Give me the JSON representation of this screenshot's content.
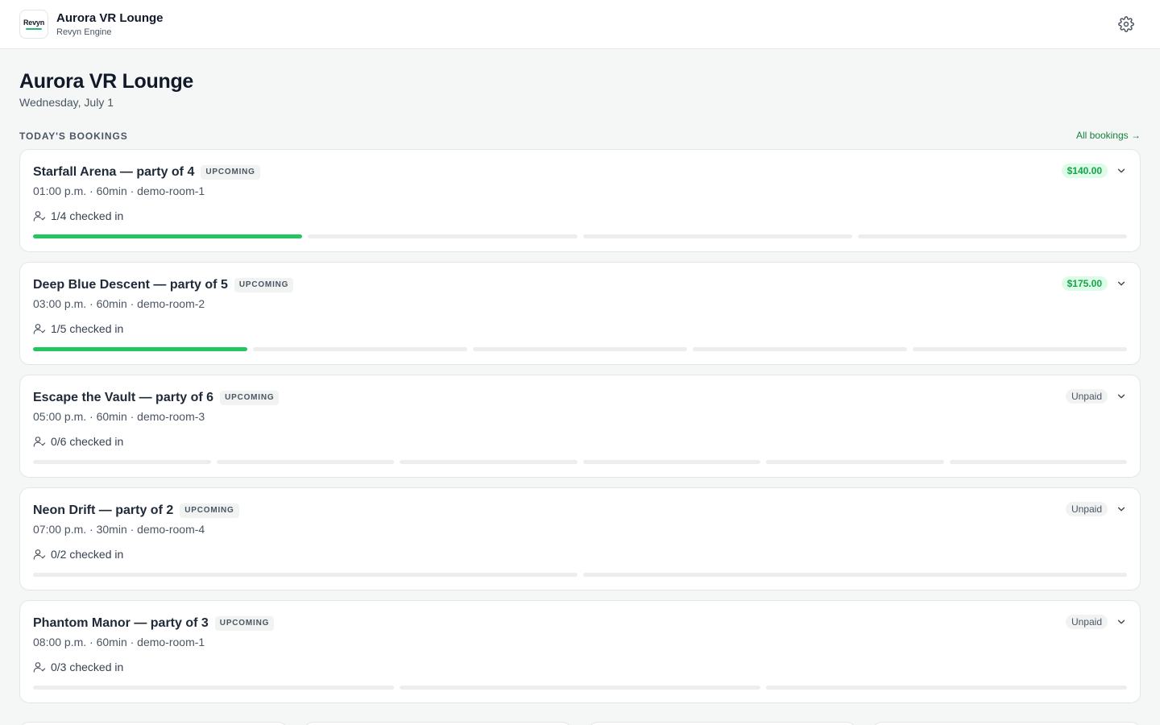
{
  "topbar": {
    "logo_text": "Revyn",
    "title": "Aurora VR Lounge",
    "subtitle": "Revyn Engine"
  },
  "page": {
    "title": "Aurora VR Lounge",
    "date": "Wednesday, July 1"
  },
  "section": {
    "label": "TODAY'S BOOKINGS",
    "link": "All bookings →"
  },
  "colors": {
    "accent": "#22c55e",
    "link": "#15803d",
    "paid_bg": "#dcfce7",
    "paid_text": "#16a34a"
  },
  "bookings": [
    {
      "title": "Starfall Arena — party of 4",
      "status": "UPCOMING",
      "meta": "01:00 p.m. · 60min · demo-room-1",
      "checkin": "1/4 checked in",
      "payment": "$140.00",
      "paid": true,
      "party": 4,
      "checked": 1
    },
    {
      "title": "Deep Blue Descent — party of 5",
      "status": "UPCOMING",
      "meta": "03:00 p.m. · 60min · demo-room-2",
      "checkin": "1/5 checked in",
      "payment": "$175.00",
      "paid": true,
      "party": 5,
      "checked": 1
    },
    {
      "title": "Escape the Vault — party of 6",
      "status": "UPCOMING",
      "meta": "05:00 p.m. · 60min · demo-room-3",
      "checkin": "0/6 checked in",
      "payment": "Unpaid",
      "paid": false,
      "party": 6,
      "checked": 0
    },
    {
      "title": "Neon Drift — party of 2",
      "status": "UPCOMING",
      "meta": "07:00 p.m. · 30min · demo-room-4",
      "checkin": "0/2 checked in",
      "payment": "Unpaid",
      "paid": false,
      "party": 2,
      "checked": 0
    },
    {
      "title": "Phantom Manor — party of 3",
      "status": "UPCOMING",
      "meta": "08:00 p.m. · 60min · demo-room-1",
      "checkin": "0/3 checked in",
      "payment": "Unpaid",
      "paid": false,
      "party": 3,
      "checked": 0
    }
  ],
  "icons": {
    "settings": "gear-icon",
    "checkin": "user-check-icon",
    "expand": "chevron-down-icon"
  }
}
